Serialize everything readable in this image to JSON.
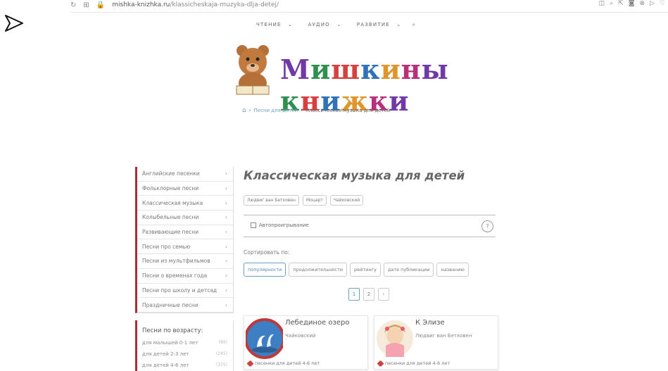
{
  "browser": {
    "reload_icon": "reload-icon",
    "apps_icon": "apps-icon",
    "lock_icon": "lock-icon",
    "url_domain": "mishka-knizhka.ru",
    "url_path": "/klassicheskaja-muzyka-dlja-detej/"
  },
  "nav": {
    "items": [
      "ЧТЕНИЕ",
      "АУДИО",
      "РАЗВИТИЕ"
    ]
  },
  "logo": {
    "text": "Мишкины книжки"
  },
  "breadcrumb": {
    "link": "Песни для детей",
    "current": "Классическая музыка для детей"
  },
  "sidebar": {
    "categories": [
      "Английские песенки",
      "Фольклорные песни",
      "Классическая музыка",
      "Колыбельные песни",
      "Развивающие песни",
      "Песни про семью",
      "Песни из мультфильмов",
      "Песни о временах года",
      "Песни про школу и детсад",
      "Праздничные песни"
    ],
    "age_heading": "Песни по возрасту:",
    "ages": [
      {
        "label": "для малышей 0-1 лет",
        "count": "(89)"
      },
      {
        "label": "для детей 2-3 лет",
        "count": "(245)"
      },
      {
        "label": "для детей 4-6 лет",
        "count": "(375)"
      }
    ]
  },
  "main": {
    "title": "Классическая музыка для детей",
    "tags": [
      "Людвиг ван Бетховен",
      "Моцарт",
      "Чайковский"
    ],
    "autoplay_label": "Автопроигрывание",
    "help_label": "?",
    "sort_label": "Сортировать по:",
    "sort_options": [
      "популярности",
      "продолжительности",
      "рейтингу",
      "дате публикации",
      "названию"
    ],
    "pages": [
      "1",
      "2",
      "›"
    ]
  },
  "cards": [
    {
      "title": "Лебединое озеро",
      "author": "Чайковский",
      "tag": "песенки для детей 4-6 лет"
    },
    {
      "title": "К Элизе",
      "author": "Людвиг ван Бетховен",
      "tag": "песенки для детей 4-6 лет"
    }
  ],
  "colors": {
    "accent": "#b02a30",
    "link": "#6fa0c8"
  }
}
